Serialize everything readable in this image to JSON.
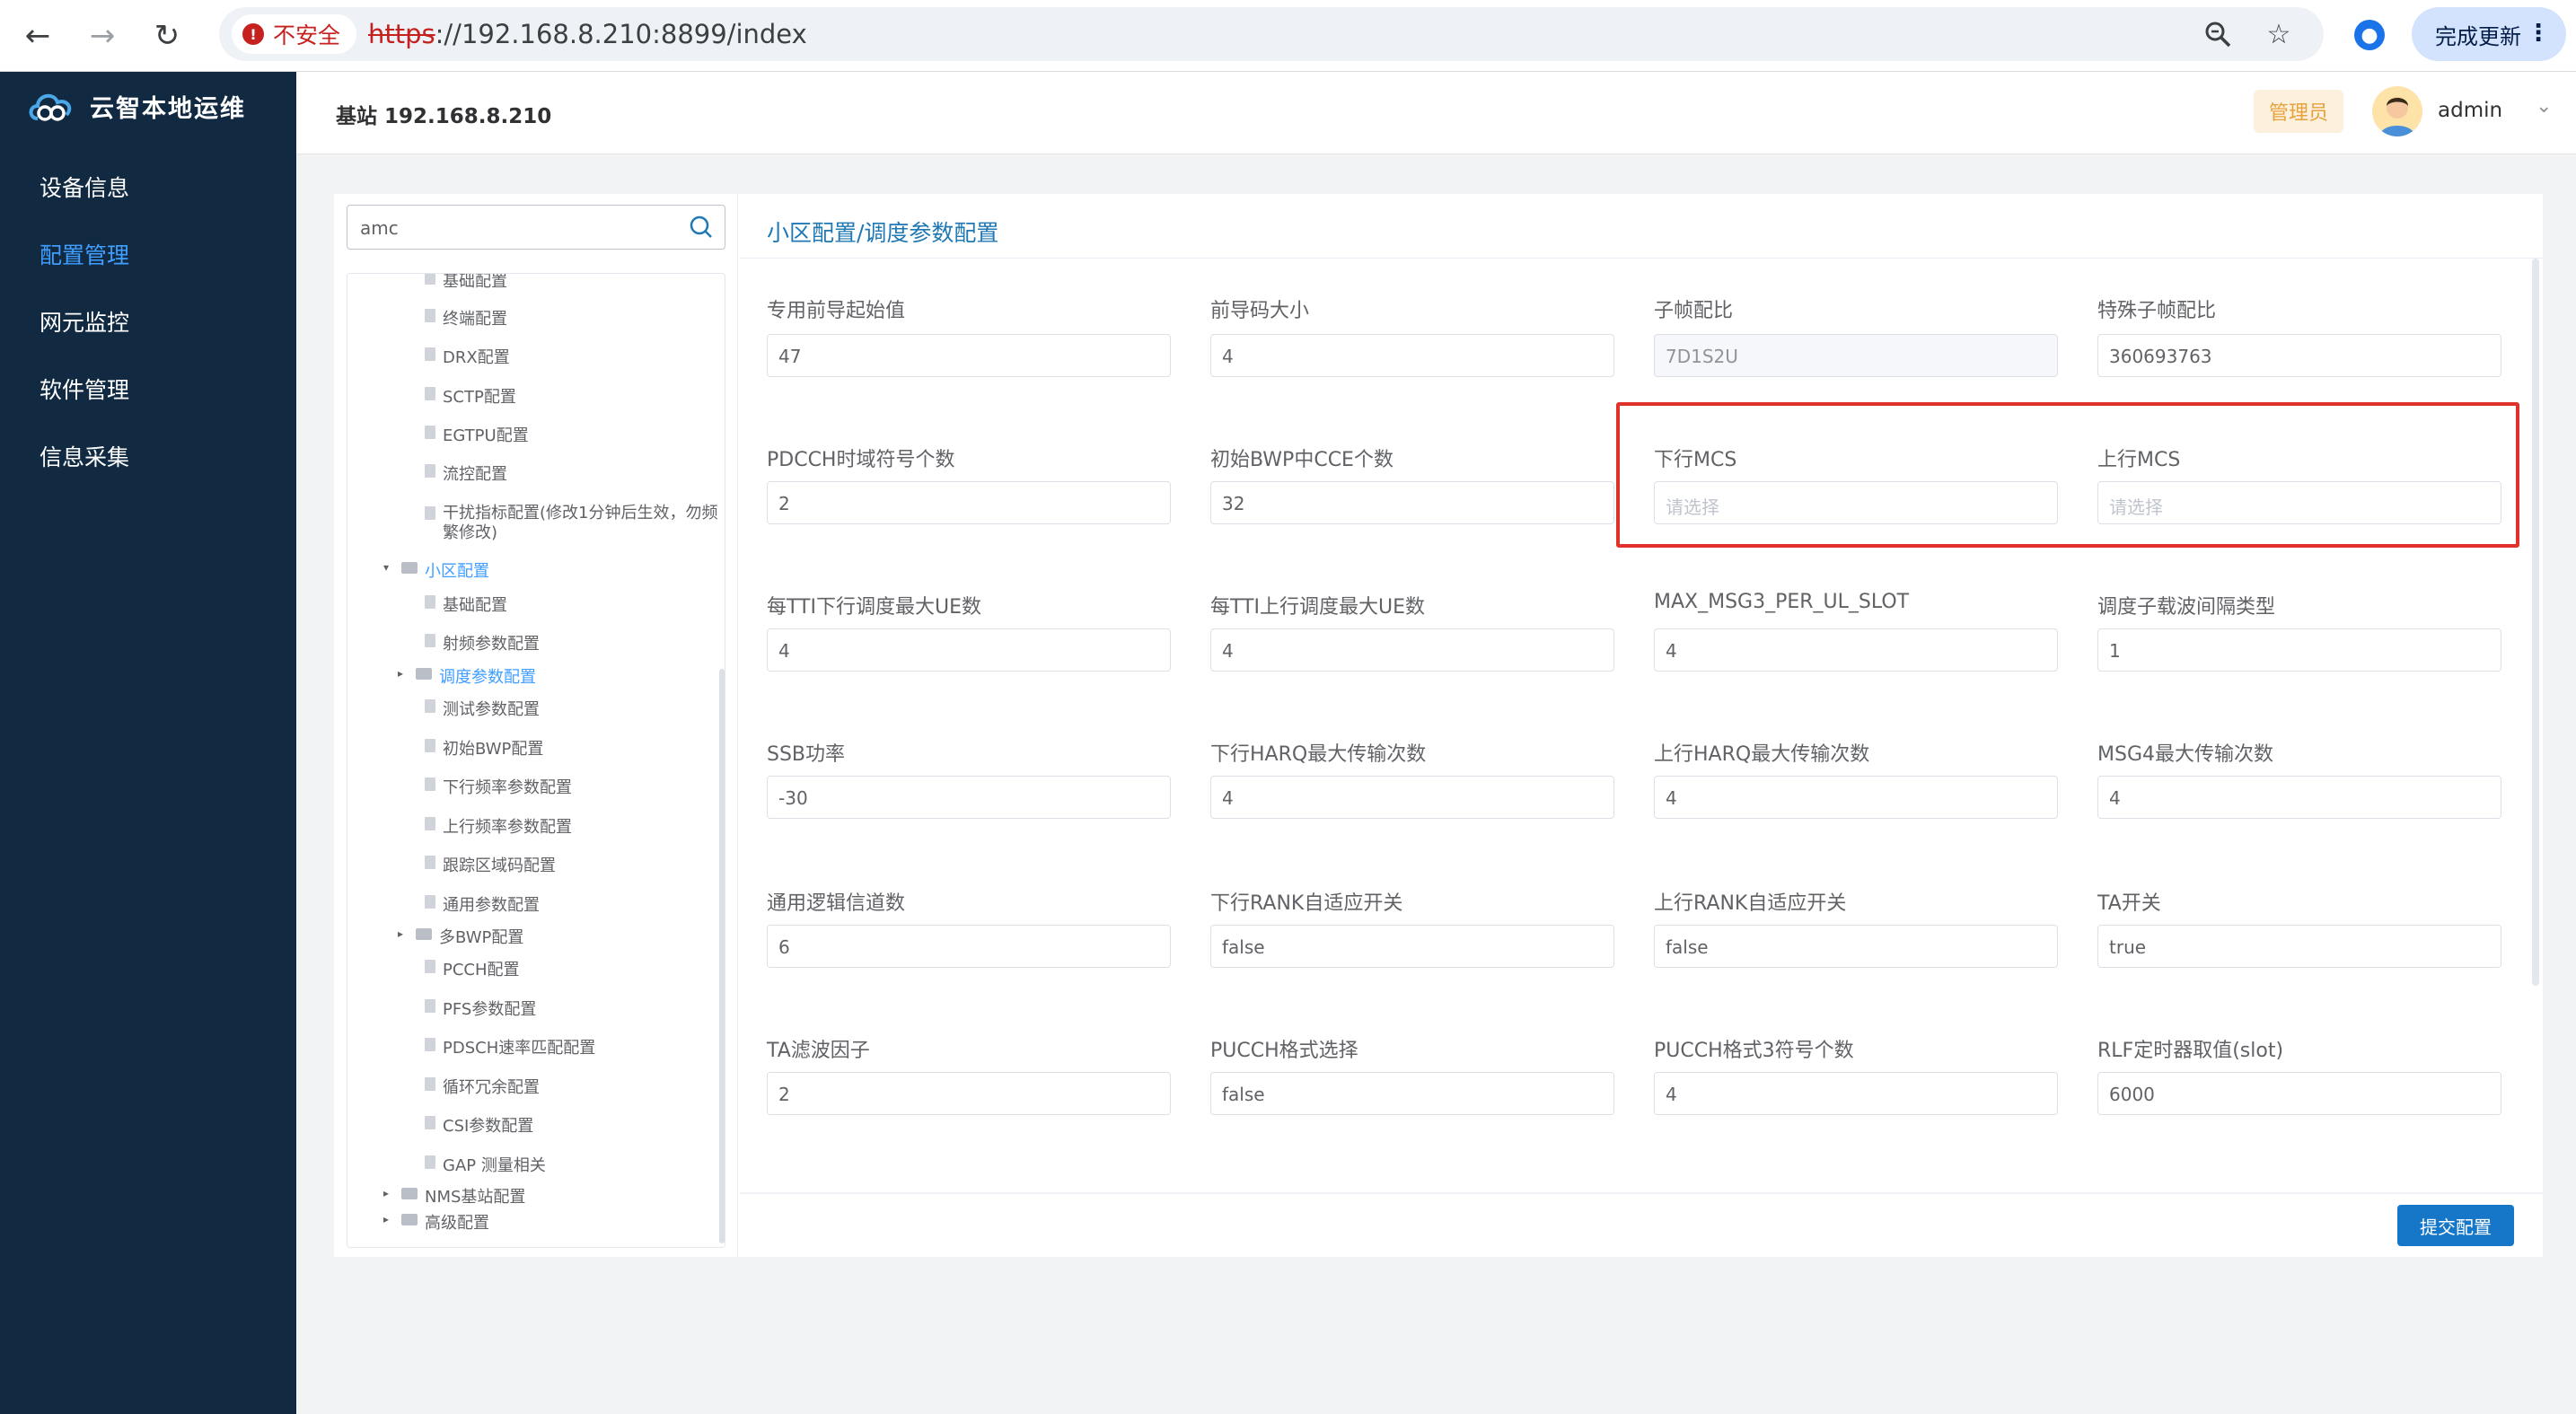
{
  "browser": {
    "security_label": "不安全",
    "url_scheme": "https",
    "url_rest": "://192.168.8.210:8899/index",
    "update_label": "完成更新"
  },
  "sidebar": {
    "app_name": "云智本地运维",
    "items": [
      {
        "label": "设备信息"
      },
      {
        "label": "配置管理"
      },
      {
        "label": "网元监控"
      },
      {
        "label": "软件管理"
      },
      {
        "label": "信息采集"
      }
    ],
    "active_index": 1
  },
  "header": {
    "station_title": "基站 192.168.8.210",
    "role": "管理员",
    "username": "admin"
  },
  "tree": {
    "search_value": "amc",
    "nodes": [
      {
        "label": "基础配置"
      },
      {
        "label": "终端配置"
      },
      {
        "label": "DRX配置"
      },
      {
        "label": "SCTP配置"
      },
      {
        "label": "EGTPU配置"
      },
      {
        "label": "流控配置"
      },
      {
        "label": "干扰指标配置(修改1分钟后生效，勿频繁修改)"
      },
      {
        "label": "小区配置"
      },
      {
        "label": "基础配置"
      },
      {
        "label": "射频参数配置"
      },
      {
        "label": "调度参数配置"
      },
      {
        "label": "测试参数配置"
      },
      {
        "label": "初始BWP配置"
      },
      {
        "label": "下行频率参数配置"
      },
      {
        "label": "上行频率参数配置"
      },
      {
        "label": "跟踪区域码配置"
      },
      {
        "label": "通用参数配置"
      },
      {
        "label": "多BWP配置"
      },
      {
        "label": "PCCH配置"
      },
      {
        "label": "PFS参数配置"
      },
      {
        "label": "PDSCH速率匹配配置"
      },
      {
        "label": "循环冗余配置"
      },
      {
        "label": "CSI参数配置"
      },
      {
        "label": "GAP 测量相关"
      },
      {
        "label": "NMS基站配置"
      },
      {
        "label": "高级配置"
      }
    ]
  },
  "form": {
    "breadcrumb": "小区配置/调度参数配置",
    "submit_label": "提交配置",
    "fields": [
      {
        "label": "专用前导起始值",
        "value": "47"
      },
      {
        "label": "前导码大小",
        "value": "4"
      },
      {
        "label": "子帧配比",
        "value": "7D1S2U"
      },
      {
        "label": "特殊子帧配比",
        "value": "360693763"
      },
      {
        "label": "PDCCH时域符号个数",
        "value": "2"
      },
      {
        "label": "初始BWP中CCE个数",
        "value": "32"
      },
      {
        "label": "下行MCS",
        "value": "请选择"
      },
      {
        "label": "上行MCS",
        "value": "请选择"
      },
      {
        "label": "每TTI下行调度最大UE数",
        "value": "4"
      },
      {
        "label": "每TTI上行调度最大UE数",
        "value": "4"
      },
      {
        "label": "MAX_MSG3_PER_UL_SLOT",
        "value": "4"
      },
      {
        "label": "调度子载波间隔类型",
        "value": "1"
      },
      {
        "label": "SSB功率",
        "value": "-30"
      },
      {
        "label": "下行HARQ最大传输次数",
        "value": "4"
      },
      {
        "label": "上行HARQ最大传输次数",
        "value": "4"
      },
      {
        "label": "MSG4最大传输次数",
        "value": "4"
      },
      {
        "label": "通用逻辑信道数",
        "value": "6"
      },
      {
        "label": "下行RANK自适应开关",
        "value": "false"
      },
      {
        "label": "上行RANK自适应开关",
        "value": "false"
      },
      {
        "label": "TA开关",
        "value": "true"
      },
      {
        "label": "TA滤波因子",
        "value": "2"
      },
      {
        "label": "PUCCH格式选择",
        "value": "false"
      },
      {
        "label": "PUCCH格式3符号个数",
        "value": "4"
      },
      {
        "label": "RLF定时器取值(slot)",
        "value": "6000"
      }
    ]
  },
  "colors": {
    "sidebar_bg": "#112a42",
    "accent": "#409eff",
    "highlight": "#e0312b",
    "primary_button": "#1677c8"
  }
}
